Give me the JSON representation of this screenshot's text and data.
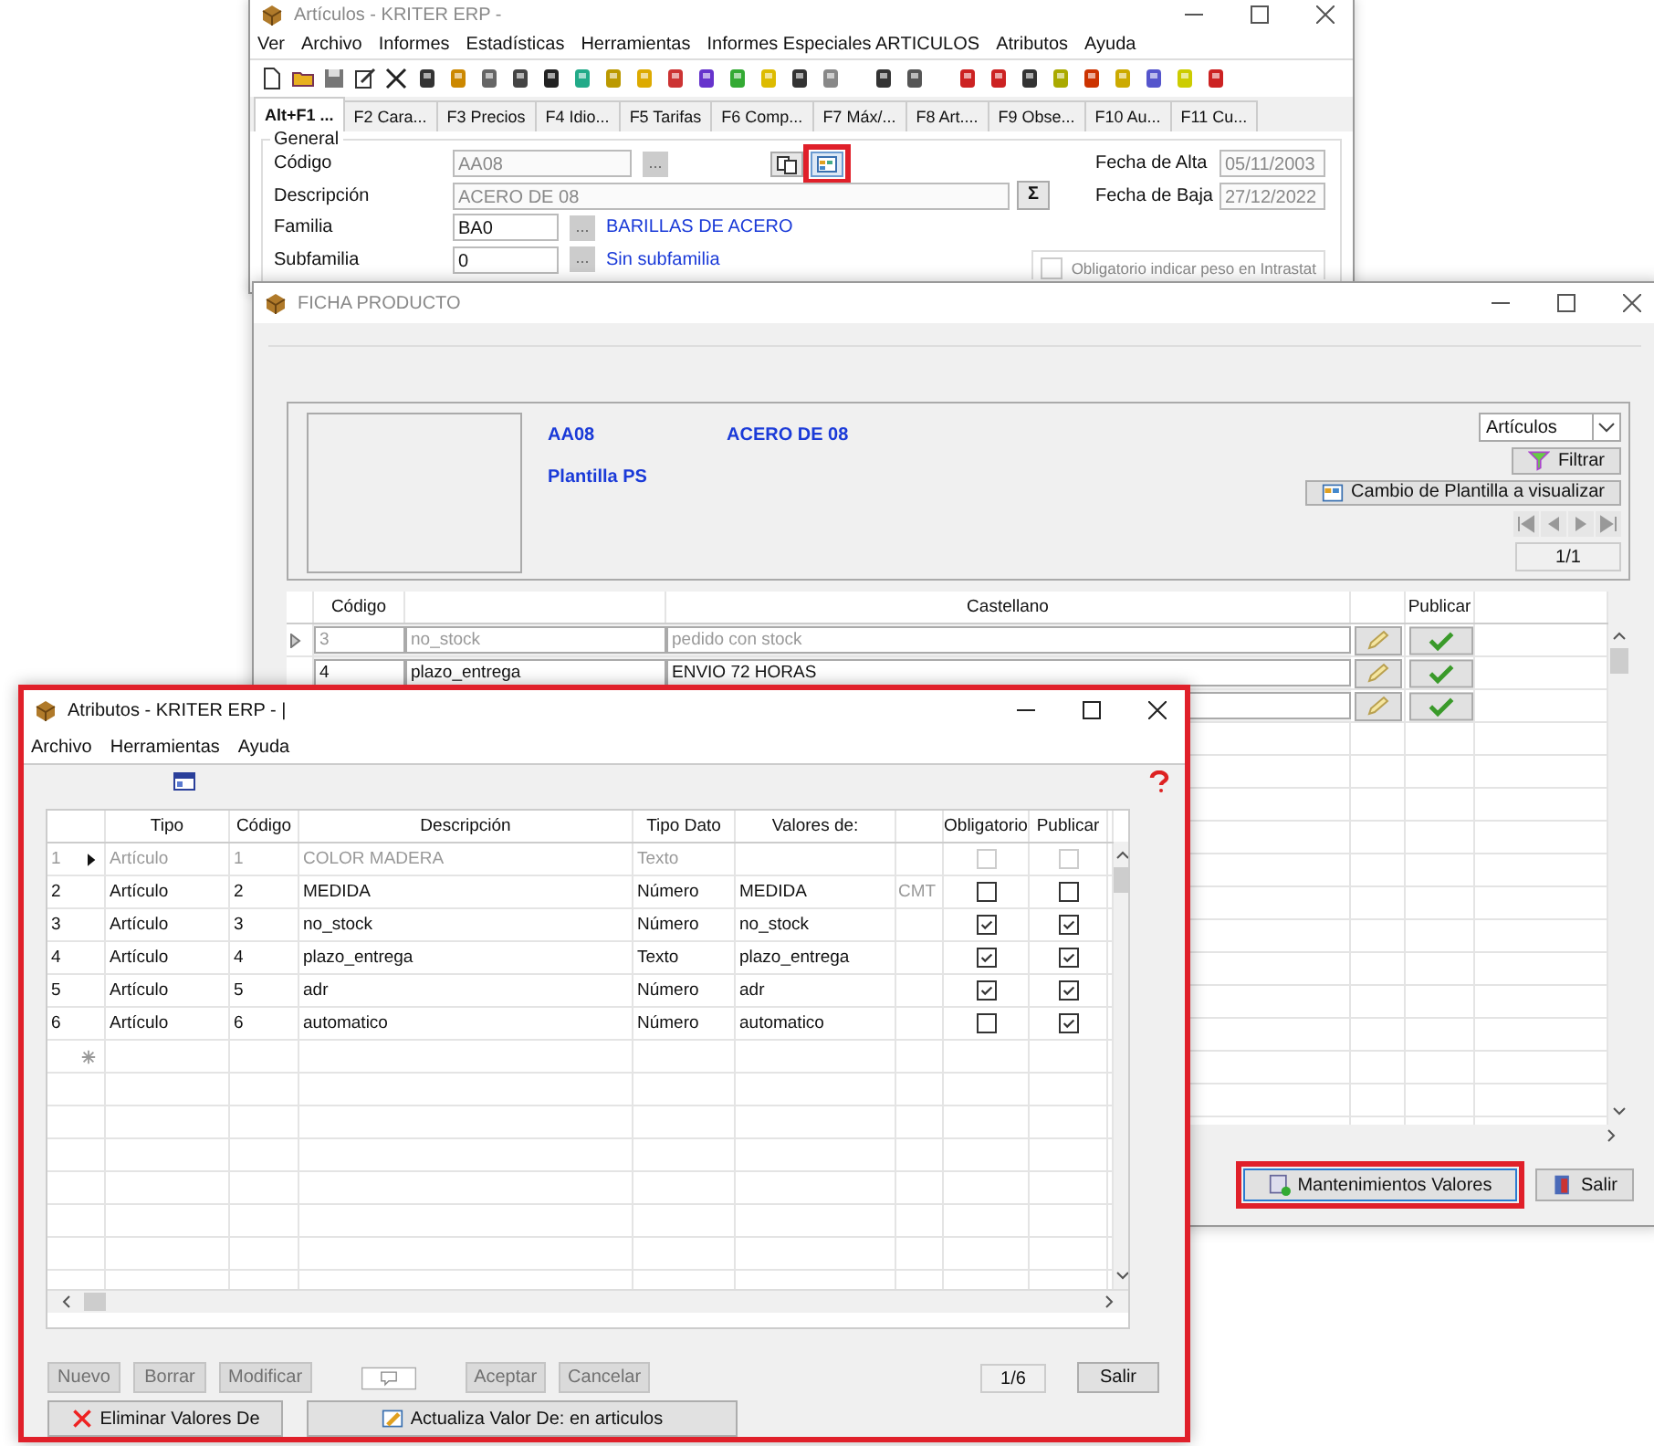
{
  "articulos_window": {
    "title": "Artículos - KRITER ERP -",
    "menu": [
      "Ver",
      "Archivo",
      "Informes",
      "Estadísticas",
      "Herramientas",
      "Informes Especiales ARTICULOS",
      "Atributos",
      "Ayuda"
    ],
    "tabs": [
      {
        "label": "Alt+F1 ...",
        "selected": true
      },
      {
        "label": "F2 Cara...",
        "selected": false
      },
      {
        "label": "F3 Precios",
        "selected": false
      },
      {
        "label": "F4 Idio...",
        "selected": false
      },
      {
        "label": "F5 Tarifas",
        "selected": false
      },
      {
        "label": "F6 Comp...",
        "selected": false
      },
      {
        "label": "F7 Máx/...",
        "selected": false
      },
      {
        "label": "F8 Art....",
        "selected": false
      },
      {
        "label": "F9 Obse...",
        "selected": false
      },
      {
        "label": "F10 Au...",
        "selected": false
      },
      {
        "label": "F11 Cu...",
        "selected": false
      }
    ],
    "general": {
      "legend": "General",
      "codigo": {
        "label": "Código",
        "value": "AA08",
        "button": "..."
      },
      "fecha_alta": {
        "label": "Fecha de Alta",
        "value": "05/11/2003"
      },
      "descripcion": {
        "label": "Descripción",
        "value": "ACERO DE 08",
        "button": "Σ"
      },
      "fecha_baja": {
        "label": "Fecha de Baja",
        "value": "27/12/2022"
      },
      "familia": {
        "label": "Familia",
        "value": "BA0",
        "button": "...",
        "name": "BARILLAS DE ACERO"
      },
      "subfamilia": {
        "label": "Subfamilia",
        "value": "0",
        "button": "...",
        "name": "Sin subfamilia"
      },
      "intrastat": {
        "label": "Obligatorio indicar peso en Intrastat",
        "checked": false,
        "disabled": true
      },
      "calendar_button": {
        "highlighted": true
      }
    }
  },
  "ficha_window": {
    "title": "FICHA PRODUCTO",
    "codigo": "AA08",
    "descripcion": "ACERO DE 08",
    "plantilla": "Plantilla PS",
    "filter_select": "Artículos",
    "filter_button": "Filtrar",
    "change_button": "Cambio de Plantilla a visualizar",
    "record_counter": "1/1",
    "columns": {
      "codigo": "Código",
      "castellano": "Castellano",
      "publicar": "Publicar"
    },
    "rows": [
      {
        "codigo": "3",
        "nombre": "no_stock",
        "castellano": "pedido con stock",
        "publicar": true,
        "current": true,
        "disabled": true
      },
      {
        "codigo": "4",
        "nombre": "plazo_entrega",
        "castellano": "ENVIO 72 HORAS",
        "publicar": true,
        "current": false,
        "disabled": false
      },
      {
        "publicar": true,
        "current": false,
        "disabled": false
      }
    ],
    "buttons": [
      {
        "label": "Mantenimientos Valores",
        "kind": "maintenance",
        "highlighted": true
      },
      {
        "label": "Salir",
        "kind": "exit",
        "highlighted": false
      }
    ]
  },
  "atributos_window": {
    "title": "Atributos - KRITER ERP - |",
    "highlighted": true,
    "menu": [
      "Archivo",
      "Herramientas",
      "Ayuda"
    ],
    "columns": {
      "tipo": "Tipo",
      "codigo": "Código",
      "descripcion": "Descripción",
      "tipo_dato": "Tipo Dato",
      "valores_de": "Valores de:",
      "obligatorio": "Obligatorio",
      "publicar": "Publicar"
    },
    "rows": [
      {
        "num": "1",
        "tipo": "Artículo",
        "codigo": "1",
        "descripcion": "COLOR MADERA",
        "tipo_dato": "Texto",
        "obligatorio": false,
        "publicar": false,
        "current": true,
        "disabled": true
      },
      {
        "num": "2",
        "tipo": "Artículo",
        "codigo": "2",
        "descripcion": "MEDIDA",
        "tipo_dato": "Número",
        "valores_de": "MEDIDA",
        "column_7": "CMT",
        "obligatorio": false,
        "publicar": false,
        "current": false,
        "disabled": false
      },
      {
        "num": "3",
        "tipo": "Artículo",
        "codigo": "3",
        "descripcion": "no_stock",
        "tipo_dato": "Número",
        "valores_de": "no_stock",
        "obligatorio": true,
        "publicar": true,
        "current": false,
        "disabled": false
      },
      {
        "num": "4",
        "tipo": "Artículo",
        "codigo": "4",
        "descripcion": "plazo_entrega",
        "tipo_dato": "Texto",
        "valores_de": "plazo_entrega",
        "obligatorio": true,
        "publicar": true,
        "current": false,
        "disabled": false
      },
      {
        "num": "5",
        "tipo": "Artículo",
        "codigo": "5",
        "descripcion": "adr",
        "tipo_dato": "Número",
        "valores_de": "adr",
        "obligatorio": true,
        "publicar": true,
        "current": false,
        "disabled": false
      },
      {
        "num": "6",
        "tipo": "Artículo",
        "codigo": "6",
        "descripcion": "automatico",
        "tipo_dato": "Número",
        "valores_de": "automatico",
        "obligatorio": false,
        "publicar": true,
        "current": false,
        "disabled": false
      }
    ],
    "edit_buttons": [
      {
        "label": "Nuevo",
        "disabled": true
      },
      {
        "label": "Borrar",
        "disabled": true
      },
      {
        "label": "Modificar",
        "disabled": true
      }
    ],
    "confirm_buttons": [
      {
        "label": "Aceptar",
        "disabled": true
      },
      {
        "label": "Cancelar",
        "disabled": true
      }
    ],
    "record_counter": "1/6",
    "exit_button": "Salir",
    "action_buttons": [
      {
        "label": "Eliminar Valores De",
        "kind": "delete"
      },
      {
        "label": "Actualiza Valor De: en articulos",
        "kind": "update"
      }
    ]
  }
}
